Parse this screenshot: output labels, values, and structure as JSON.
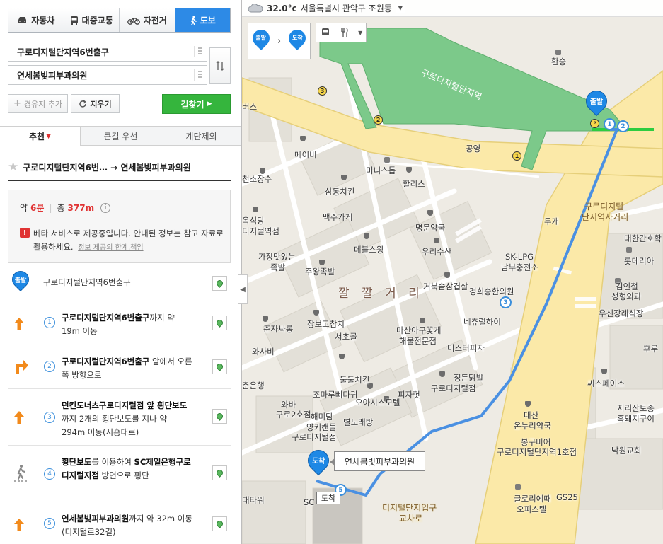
{
  "modes": [
    {
      "label": "자동차",
      "icon": "car-icon",
      "active": false
    },
    {
      "label": "대중교통",
      "icon": "bus-icon",
      "active": false
    },
    {
      "label": "자전거",
      "icon": "bicycle-icon",
      "active": false
    },
    {
      "label": "도보",
      "icon": "walk-icon",
      "active": true
    }
  ],
  "search": {
    "origin": "구로디지털단지역6번출구",
    "destination": "연세봄빛피부과의원",
    "add_waypoint": "경유지 추가",
    "clear": "지우기",
    "find_route": "길찾기"
  },
  "tabs": [
    {
      "label": "추천",
      "active": true
    },
    {
      "label": "큰길 우선",
      "active": false
    },
    {
      "label": "계단제외",
      "active": false
    }
  ],
  "route_title": "구로디지털단지역6번… → 연세봄빛피부과의원",
  "summary": {
    "approx": "약",
    "time": "6분",
    "total": "총",
    "distance": "377m",
    "notice": "베타 서비스로 제공중입니다. 안내된 정보는 참고 자료로 활용하세요.",
    "notice_link": "정보 제공의 한계,책임"
  },
  "start": {
    "badge": "출발",
    "label": "구로디지털단지역6번출구"
  },
  "steps": [
    {
      "num": "1",
      "icon": "arrow-straight-icon",
      "bold": "구로디지털단지역6번출구",
      "text": "까지 약 19m 이동"
    },
    {
      "num": "2",
      "icon": "arrow-right-turn-icon",
      "bold": "구로디지털단지역6번출구",
      "text": " 앞에서 오른쪽 방향으로"
    },
    {
      "num": "3",
      "icon": "arrow-straight-icon",
      "bold": "던킨도너츠구로디지털점 앞 횡단보도",
      "text": "까지 2개의 횡단보도를 지나 약 294m 이동(시흥대로)"
    },
    {
      "num": "4",
      "icon": "crosswalk-icon",
      "bold": "횡단보도",
      "text": "를 이용하여 ",
      "bold2": "SC제일은행구로디지털지점",
      "text2": " 방면으로 횡단"
    },
    {
      "num": "5",
      "icon": "arrow-straight-icon",
      "bold": "연세봄빛피부과의원",
      "text": "까지 약 32m 이동(디지털로32길)"
    }
  ],
  "map": {
    "weather": {
      "temp": "32.0°c",
      "location": "서울특별시 관악구 조원동"
    },
    "pin_start": "출발",
    "pin_end": "도착",
    "dest_callout": "연세봄빛피부과의원",
    "dest_tag": "도착",
    "colors": {
      "route": "#4a90e2",
      "route_start": "#2ecc40",
      "main_road": "#fbe9a8",
      "station_area": "#7cc98a",
      "pin": "#1e88e5"
    },
    "labels": [
      {
        "t": "환승",
        "cls": ""
      },
      {
        "t": "구로디지털단지역",
        "cls": "station"
      },
      {
        "t": "버스",
        "cls": ""
      },
      {
        "t": "공영",
        "cls": ""
      },
      {
        "t": "메이비",
        "cls": ""
      },
      {
        "t": "미니스톱",
        "cls": ""
      },
      {
        "t": "천소장수",
        "cls": ""
      },
      {
        "t": "삼동치킨",
        "cls": ""
      },
      {
        "t": "할리스",
        "cls": ""
      },
      {
        "t": "구로디지털",
        "cls": "road"
      },
      {
        "t": "단지역사거리",
        "cls": "road"
      },
      {
        "t": "대한간호학",
        "cls": ""
      },
      {
        "t": "옥식당",
        "cls": ""
      },
      {
        "t": "디지털역점",
        "cls": ""
      },
      {
        "t": "맥주가게",
        "cls": ""
      },
      {
        "t": "두개",
        "cls": ""
      },
      {
        "t": "명문약국",
        "cls": ""
      },
      {
        "t": "데블스윙",
        "cls": ""
      },
      {
        "t": "가장맛있는",
        "cls": ""
      },
      {
        "t": "족발",
        "cls": ""
      },
      {
        "t": "주왕족발",
        "cls": ""
      },
      {
        "t": "우리수산",
        "cls": ""
      },
      {
        "t": "SK-LPG",
        "cls": ""
      },
      {
        "t": "남부충전소",
        "cls": ""
      },
      {
        "t": "롯데리아",
        "cls": ""
      },
      {
        "t": "깔 깔 거 리",
        "cls": "dist"
      },
      {
        "t": "거북솥삼겹살",
        "cls": ""
      },
      {
        "t": "경희송한의원",
        "cls": ""
      },
      {
        "t": "김인철",
        "cls": ""
      },
      {
        "t": "성형외과",
        "cls": ""
      },
      {
        "t": "우신장례식장",
        "cls": ""
      },
      {
        "t": "춘자싸롱",
        "cls": ""
      },
      {
        "t": "장보고참치",
        "cls": ""
      },
      {
        "t": "네츄럴하이",
        "cls": ""
      },
      {
        "t": "서초골",
        "cls": ""
      },
      {
        "t": "마산아구꽃게",
        "cls": ""
      },
      {
        "t": "해물전문점",
        "cls": ""
      },
      {
        "t": "와사비",
        "cls": ""
      },
      {
        "t": "미스터피자",
        "cls": ""
      },
      {
        "t": "후루",
        "cls": ""
      },
      {
        "t": "둘둘치킨",
        "cls": ""
      },
      {
        "t": "정든닭발",
        "cls": ""
      },
      {
        "t": "구로디지털점",
        "cls": ""
      },
      {
        "t": "춘은행",
        "cls": ""
      },
      {
        "t": "씨스페이스",
        "cls": ""
      },
      {
        "t": "조마루뼈다귀",
        "cls": ""
      },
      {
        "t": "피자헛",
        "cls": ""
      },
      {
        "t": "와바",
        "cls": ""
      },
      {
        "t": "구로2호점",
        "cls": ""
      },
      {
        "t": "오아시스모텔",
        "cls": ""
      },
      {
        "t": "대산",
        "cls": ""
      },
      {
        "t": "온누리약국",
        "cls": ""
      },
      {
        "t": "지리산토종",
        "cls": ""
      },
      {
        "t": "흑돼지구이",
        "cls": ""
      },
      {
        "t": "해미담",
        "cls": ""
      },
      {
        "t": "양키캔들",
        "cls": ""
      },
      {
        "t": "별노래방",
        "cls": ""
      },
      {
        "t": "봉구비어",
        "cls": ""
      },
      {
        "t": "구로디지털단지역1호점",
        "cls": ""
      },
      {
        "t": "구로디지털점",
        "cls": ""
      },
      {
        "t": "낙원교회",
        "cls": ""
      },
      {
        "t": "GS25",
        "cls": ""
      },
      {
        "t": "글로리에때",
        "cls": ""
      },
      {
        "t": "오피스텔",
        "cls": ""
      },
      {
        "t": "대타워",
        "cls": ""
      },
      {
        "t": "SC",
        "cls": ""
      },
      {
        "t": "디지털단지입구",
        "cls": "road"
      },
      {
        "t": "교차로",
        "cls": "road"
      }
    ]
  }
}
